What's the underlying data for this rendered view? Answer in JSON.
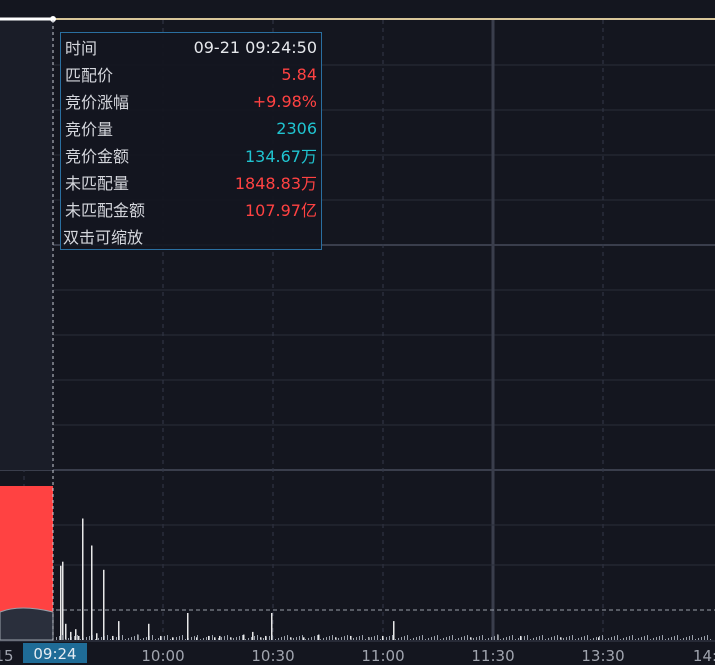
{
  "tooltip": {
    "rows": [
      {
        "label": "时间",
        "value": "09-21 09:24:50",
        "color": "#e6e8ec"
      },
      {
        "label": "匹配价",
        "value": "5.84",
        "color": "#ff4242"
      },
      {
        "label": "竞价涨幅",
        "value": "+9.98%",
        "color": "#ff4242"
      },
      {
        "label": "竞价量",
        "value": "2306",
        "color": "#20c4d0"
      },
      {
        "label": "竞价金额",
        "value": "134.67万",
        "color": "#20c4d0"
      },
      {
        "label": "未匹配量",
        "value": "1848.83万",
        "color": "#ff4242"
      },
      {
        "label": "未匹配金额",
        "value": "107.97亿",
        "color": "#ff4242"
      }
    ],
    "hint": "双击可缩放"
  },
  "x_axis": {
    "cursor_label": "09:24",
    "left_cut_label": "15",
    "ticks": [
      "10:00",
      "10:30",
      "11:00",
      "11:30",
      "13:30",
      "14:"
    ]
  },
  "colors": {
    "background": "#14161f",
    "grid": "#2a2d3a",
    "price_line": "#d9c79a",
    "auction_volume": "#ff4242",
    "volume_bar": "#e8e8e8"
  },
  "chart_data": {
    "type": "bar",
    "title": "",
    "series": [
      {
        "values": [
          2306
        ]
      }
    ],
    "volume_bars": [
      0.9,
      0.55,
      0.58,
      0.12,
      0.7,
      0.06,
      0.08,
      0.03,
      0.52,
      0.05,
      0.03,
      0.14,
      0.04,
      0.12,
      0.03,
      0.02,
      0.2,
      0.02,
      0.03,
      0.02,
      0.03,
      0.02,
      0.04,
      0.06,
      0.02,
      0.03,
      0.2,
      0.02,
      0.02,
      0.04,
      0.02,
      0.03,
      0.02,
      0.03,
      0.14,
      0.02,
      0.04,
      0.03,
      0.02,
      0.02
    ]
  }
}
